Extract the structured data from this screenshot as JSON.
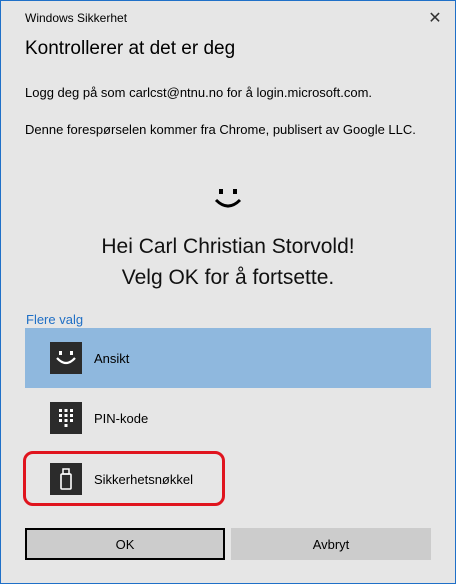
{
  "window": {
    "title": "Windows Sikkerhet",
    "close_glyph": "✕"
  },
  "main": {
    "heading": "Kontrollerer at det er deg",
    "signin_text": "Logg deg på som carlcst@ntnu.no for å login.microsoft.com.",
    "request_text": "Denne forespørselen kommer fra Chrome, publisert av Google LLC.",
    "greeting_line1": "Hei Carl Christian Storvold!",
    "greeting_line2": "Velg OK for å fortsette."
  },
  "options": {
    "more_label": "Flere valg",
    "items": [
      {
        "label": "Ansikt",
        "icon": "face-icon",
        "selected": true
      },
      {
        "label": "PIN-kode",
        "icon": "pin-keypad-icon",
        "selected": false
      },
      {
        "label": "Sikkerhetsnøkkel",
        "icon": "usb-key-icon",
        "selected": false
      }
    ]
  },
  "buttons": {
    "ok_label": "OK",
    "cancel_label": "Avbryt"
  },
  "colors": {
    "selected_option_bg": "#8fb8de",
    "link": "#1f6fc5",
    "highlight_border": "#e0141e",
    "window_border": "#1f70c8"
  }
}
